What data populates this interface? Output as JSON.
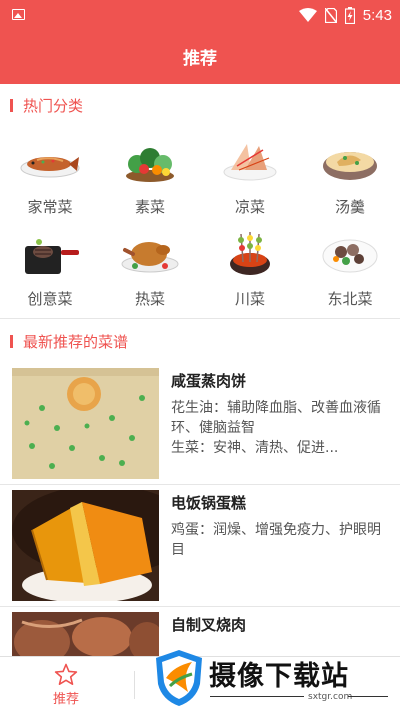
{
  "status_bar": {
    "time": "5:43",
    "icons": [
      "image-icon",
      "wifi-icon",
      "no-sim-icon",
      "battery-charging-icon"
    ]
  },
  "app_bar": {
    "title": "推荐"
  },
  "hot_categories": {
    "title": "热门分类",
    "items": [
      {
        "label": "家常菜",
        "icon": "fish-dish-icon"
      },
      {
        "label": "素菜",
        "icon": "vegetable-basket-icon"
      },
      {
        "label": "凉菜",
        "icon": "cold-dish-icon"
      },
      {
        "label": "汤羹",
        "icon": "soup-pot-icon"
      },
      {
        "label": "创意菜",
        "icon": "grill-pan-icon"
      },
      {
        "label": "热菜",
        "icon": "roast-chicken-icon"
      },
      {
        "label": "川菜",
        "icon": "skewers-pot-icon"
      },
      {
        "label": "东北菜",
        "icon": "stew-plate-icon"
      }
    ]
  },
  "latest_recipes": {
    "title": "最新推荐的菜谱",
    "items": [
      {
        "title": "咸蛋蒸肉饼",
        "desc": "花生油：辅助降血脂、改善血液循环、健脑益智\n生菜：安神、清热、促进..."
      },
      {
        "title": "电饭锅蛋糕",
        "desc": "鸡蛋：润燥、增强免疫力、护眼明目"
      },
      {
        "title": "自制叉烧肉",
        "desc": ""
      }
    ]
  },
  "bottom_nav": {
    "items": [
      {
        "label": "推荐",
        "icon": "star-outline-icon",
        "active": true
      }
    ]
  },
  "watermark": {
    "text": "摄像下载站",
    "domain": "sxtgr.com"
  },
  "colors": {
    "primary": "#ef5350",
    "text": "#333333",
    "muted": "#555555"
  }
}
